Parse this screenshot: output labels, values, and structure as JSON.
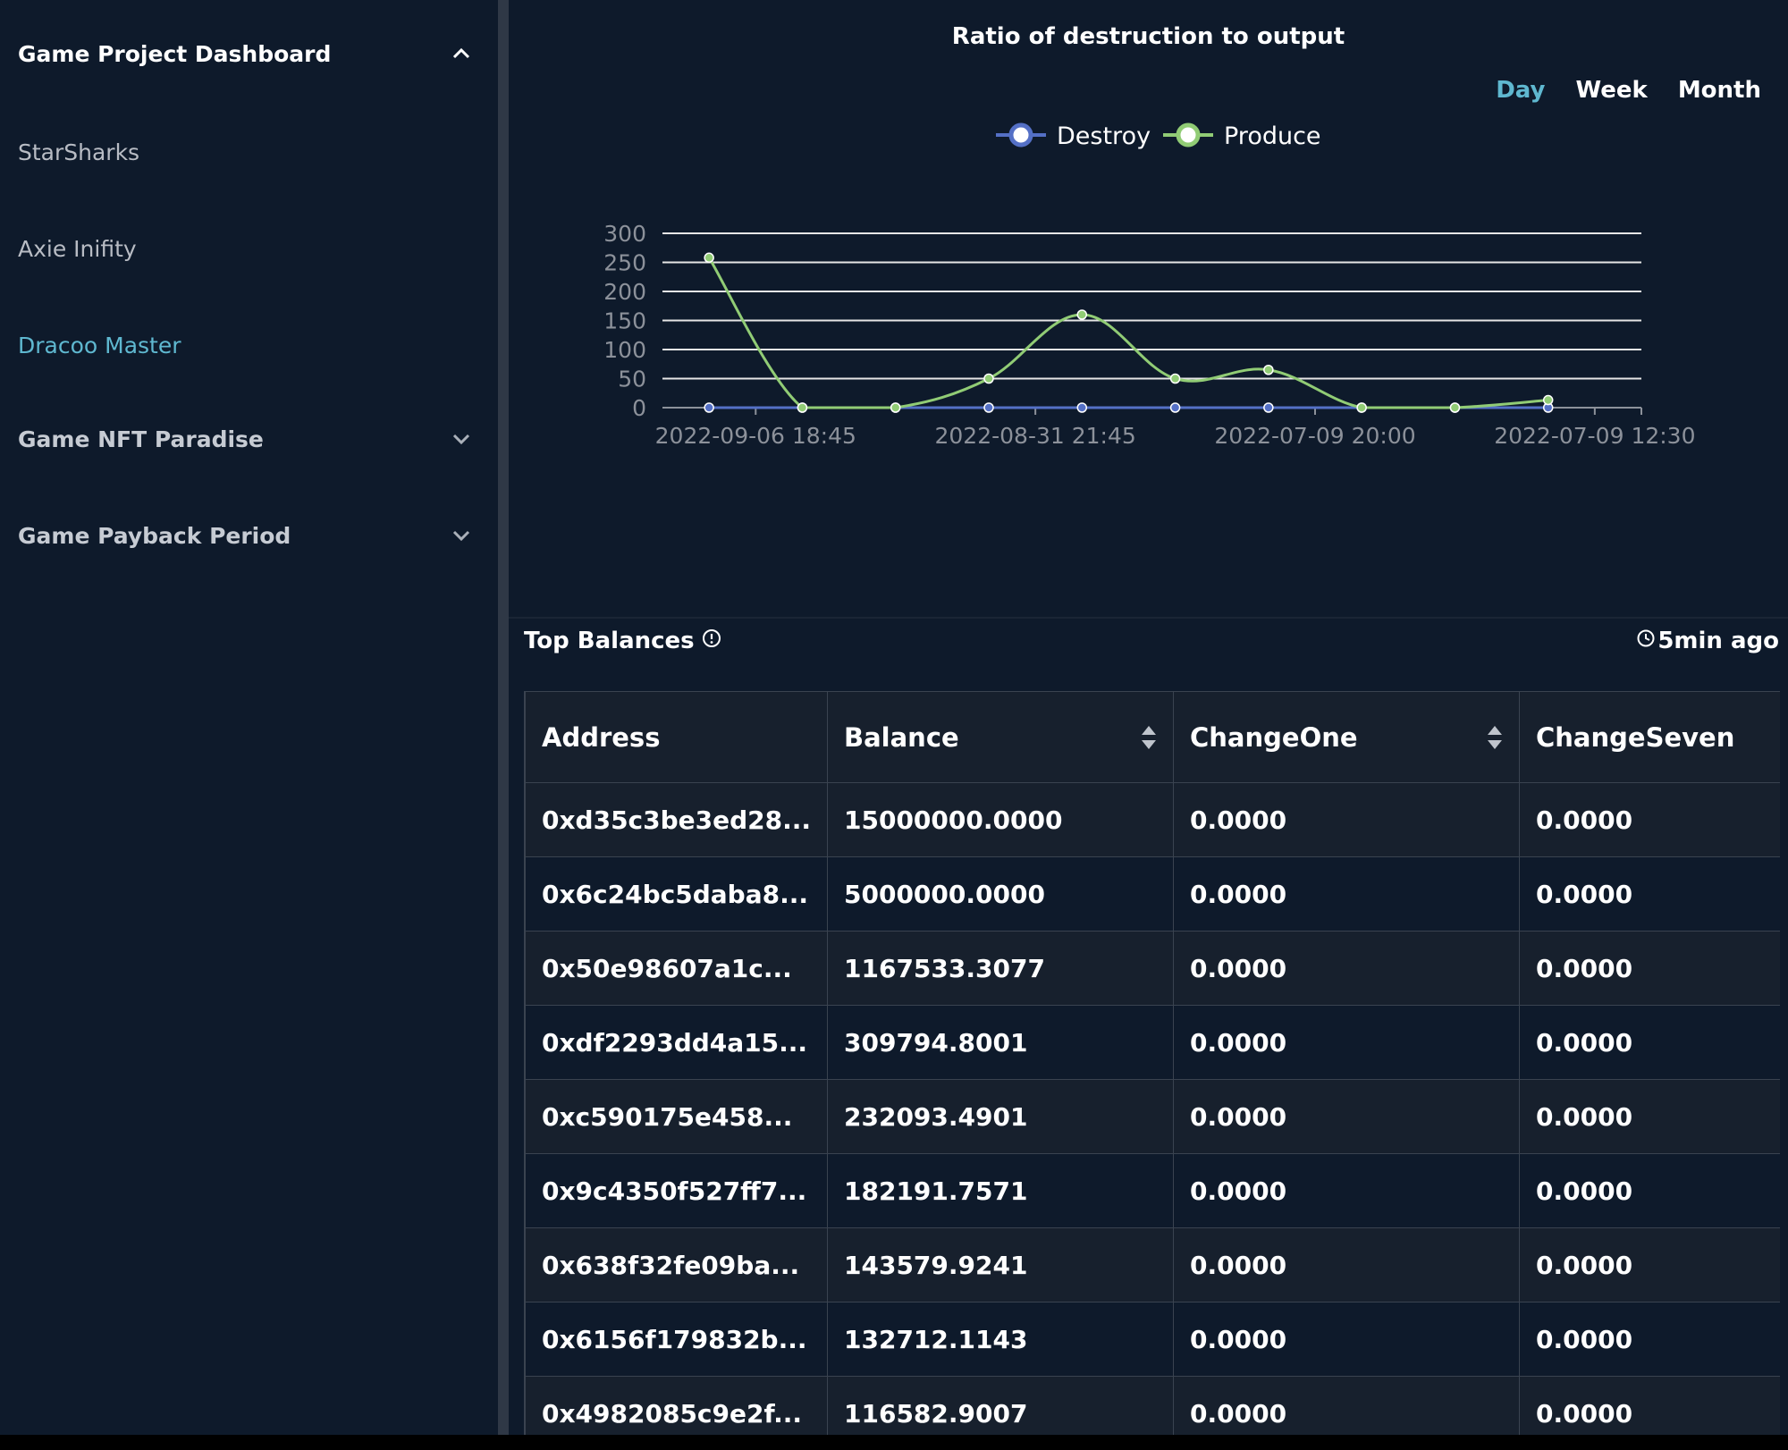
{
  "sidebar": {
    "groups": [
      {
        "label": "Game Project Dashboard",
        "expanded": true,
        "icon": "chevron-up-icon",
        "items": [
          {
            "label": "StarSharks",
            "active": false
          },
          {
            "label": "Axie Inifity",
            "active": false
          },
          {
            "label": "Dracoo Master",
            "active": true
          }
        ]
      },
      {
        "label": "Game NFT Paradise",
        "expanded": false,
        "icon": "chevron-down-icon"
      },
      {
        "label": "Game Payback Period",
        "expanded": false,
        "icon": "chevron-down-icon"
      }
    ]
  },
  "chart": {
    "title": "Ratio of destruction to output",
    "range_tabs": [
      "Day",
      "Week",
      "Month"
    ],
    "active_range": "Day"
  },
  "chart_data": {
    "type": "line",
    "title": "Ratio of destruction to output",
    "xlabel": "",
    "ylabel": "",
    "ylim": [
      0,
      300
    ],
    "yticks": [
      0,
      50,
      100,
      150,
      200,
      250,
      300
    ],
    "x_tick_labels": [
      "2022-09-06  18:45",
      "2022-08-31  21:45",
      "2022-07-09  20:00",
      "2022-07-09  12:30"
    ],
    "x_tick_label_positions": [
      1,
      4,
      7,
      10
    ],
    "grid": true,
    "legend": "top-center",
    "series": [
      {
        "name": "Destroy",
        "color": "#5470c6",
        "values": [
          0,
          0,
          0,
          0,
          0,
          0,
          0,
          0,
          0,
          0
        ]
      },
      {
        "name": "Produce",
        "color": "#91cc75",
        "values": [
          258,
          0,
          0,
          50,
          160,
          50,
          65,
          0,
          0,
          13
        ]
      }
    ]
  },
  "top_balances": {
    "title": "Top Balances",
    "updated": "5min ago",
    "columns": [
      "Address",
      "Balance",
      "ChangeOne",
      "ChangeSeven"
    ],
    "sortable": [
      false,
      true,
      true,
      false
    ],
    "rows": [
      [
        "0xd35c3be3ed28...",
        "15000000.0000",
        "0.0000",
        "0.0000"
      ],
      [
        "0x6c24bc5daba8...",
        "5000000.0000",
        "0.0000",
        "0.0000"
      ],
      [
        "0x50e98607a1c...",
        "1167533.3077",
        "0.0000",
        "0.0000"
      ],
      [
        "0xdf2293dd4a15...",
        "309794.8001",
        "0.0000",
        "0.0000"
      ],
      [
        "0xc590175e458...",
        "232093.4901",
        "0.0000",
        "0.0000"
      ],
      [
        "0x9c4350f527ff7...",
        "182191.7571",
        "0.0000",
        "0.0000"
      ],
      [
        "0x638f32fe09ba...",
        "143579.9241",
        "0.0000",
        "0.0000"
      ],
      [
        "0x6156f179832b...",
        "132712.1143",
        "0.0000",
        "0.0000"
      ],
      [
        "0x4982085c9e2f...",
        "116582.9007",
        "0.0000",
        "0.0000"
      ]
    ]
  },
  "colors": {
    "background": "#0e1a2b",
    "accent": "#5fb8d0",
    "destroy": "#5470c6",
    "produce": "#91cc75"
  }
}
